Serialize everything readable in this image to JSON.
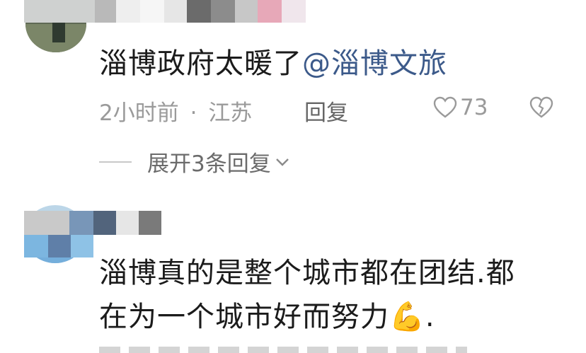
{
  "comments": [
    {
      "text": "淄博政府太暖了",
      "mention": "@淄博文旅",
      "time": "2小时前",
      "separator": "·",
      "location": "江苏",
      "reply_label": "回复",
      "likes": "73",
      "expand_label": "展开3条回复"
    },
    {
      "text_line1": "淄博真的是整个城市都在团结.都",
      "text_line2": "在为一个城市好而努力",
      "emoji": "💪",
      "trailing": "."
    }
  ],
  "colors": {
    "mention": "#3c5a8a",
    "meta": "#9a9a9a",
    "emoji": "#f5b500"
  },
  "icons": [
    "heart-outline-icon",
    "broken-heart-icon",
    "chevron-down-icon",
    "flexed-biceps-emoji"
  ]
}
